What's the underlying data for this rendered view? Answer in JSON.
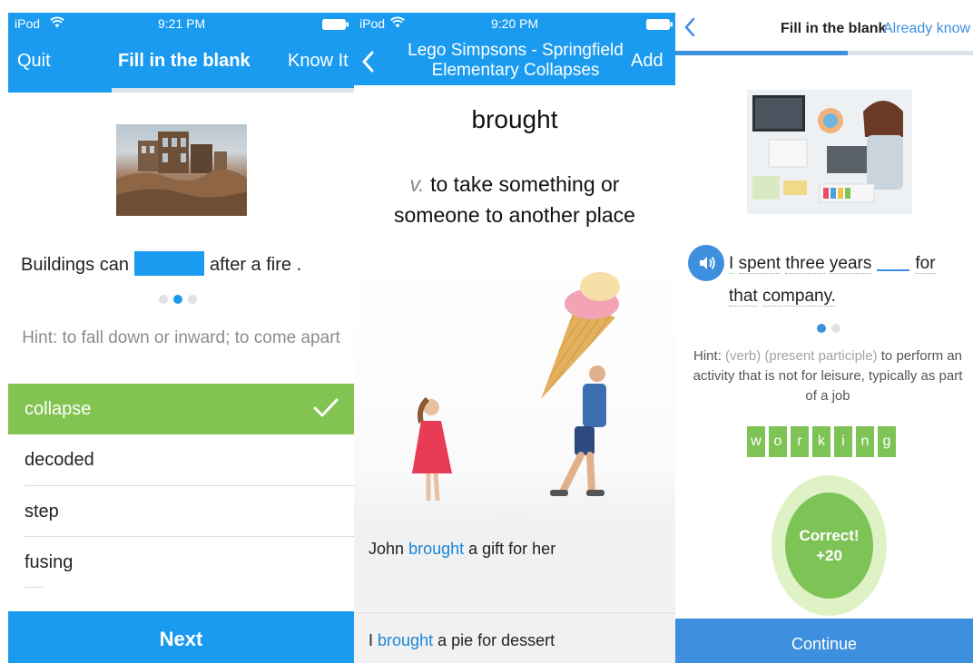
{
  "panel1": {
    "status": {
      "device": "iPod",
      "time": "9:21 PM"
    },
    "nav": {
      "left": "Quit",
      "title": "Fill in the blank",
      "right": "Know It"
    },
    "progress": 0.3,
    "sentence": {
      "before": "Buildings can",
      "after": "after a fire ."
    },
    "pager": {
      "count": 3,
      "active": 1
    },
    "hint": "Hint: to fall down or inward; to come apart",
    "options": [
      {
        "label": "collapse",
        "correct": true
      },
      {
        "label": "decoded",
        "correct": false
      },
      {
        "label": "step",
        "correct": false
      },
      {
        "label": "fusing",
        "correct": false
      }
    ],
    "next_label": "Next",
    "colors": {
      "primary": "#1a9bef",
      "correct": "#82c352"
    }
  },
  "panel2": {
    "status": {
      "device": "iPod",
      "time": "9:20 PM"
    },
    "nav": {
      "back_icon": "chevron-left-icon",
      "title_line1": "Lego Simpsons - Springfield",
      "title_line2": "Elementary Collapses",
      "right": "Add"
    },
    "word": "brought",
    "definition": {
      "pos": "v.",
      "line1": "to take something or",
      "line2": "someone to another place"
    },
    "examples": [
      {
        "before": "John",
        "word": "brought",
        "after": "a gift for her"
      },
      {
        "before": "I",
        "word": "brought",
        "after": "a pie for dessert"
      }
    ]
  },
  "panel3": {
    "nav": {
      "back_icon": "chevron-left-icon",
      "title": "Fill in the blank",
      "right": "Already know"
    },
    "progress": 0.58,
    "sentence": {
      "w1": "I",
      "w2": "spent",
      "w3": "three",
      "w4": "years",
      "w5": "for",
      "w6": "that",
      "w7": "company."
    },
    "pager": {
      "count": 2,
      "active": 0
    },
    "hint": {
      "label": "Hint:",
      "gram": "(verb) (present participle)",
      "text1": "to perform an",
      "line2": "activity that is not for leisure, typically as part",
      "line3": "of a job"
    },
    "letters": [
      "w",
      "o",
      "r",
      "k",
      "i",
      "n",
      "g"
    ],
    "result": {
      "line1": "Correct!",
      "line2": "+20"
    },
    "continue_label": "Continue",
    "colors": {
      "primary": "#3e8fde",
      "correct": "#7ec356"
    }
  }
}
